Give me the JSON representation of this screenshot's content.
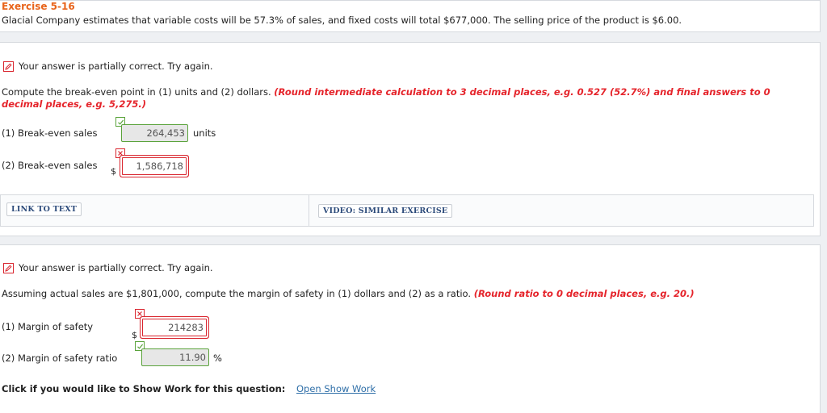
{
  "exercise": {
    "title": "Exercise 5-16",
    "description": "Glacial Company estimates that variable costs will be 57.3% of sales, and fixed costs will total $677,000. The selling price of the product is $6.00."
  },
  "part1": {
    "feedback": "Your answer is partially correct.  Try again.",
    "prompt": "Compute the break-even point in (1) units and (2) dollars.",
    "instruction": "(Round intermediate calculation to 3 decimal places, e.g. 0.527 (52.7%) and final answers to 0 decimal places, e.g. 5,275.)",
    "rows": [
      {
        "label": "(1)  Break-even sales",
        "prefix": "",
        "value": "264,453",
        "unit": "units",
        "status": "correct"
      },
      {
        "label": "(2)  Break-even sales",
        "prefix": "$",
        "value": "1,586,718",
        "unit": "",
        "status": "incorrect"
      }
    ]
  },
  "links": {
    "link_to_text": "LINK TO TEXT",
    "video": "VIDEO: SIMILAR EXERCISE"
  },
  "part2": {
    "feedback": "Your answer is partially correct.  Try again.",
    "prompt": "Assuming actual sales are $1,801,000, compute the margin of safety in (1) dollars and (2) as a ratio.",
    "instruction": "(Round ratio to 0 decimal places, e.g. 20.)",
    "rows": [
      {
        "label": "(1)  Margin of safety",
        "prefix": "$",
        "value": "214283",
        "unit": "",
        "status": "incorrect"
      },
      {
        "label": "(2)  Margin of safety ratio",
        "prefix": "",
        "value": "11.90",
        "unit": "%",
        "status": "correct"
      }
    ]
  },
  "show_work": {
    "label": "Click if you would like to Show Work for this question:",
    "link": "Open Show Work"
  },
  "colors": {
    "title": "#e8641b",
    "error": "#d9262f",
    "correct": "#5aa33b",
    "link": "#2f6fa8"
  },
  "icons": {
    "feedback": "pencil-edit-icon",
    "correct": "check-icon",
    "incorrect": "x-icon"
  }
}
